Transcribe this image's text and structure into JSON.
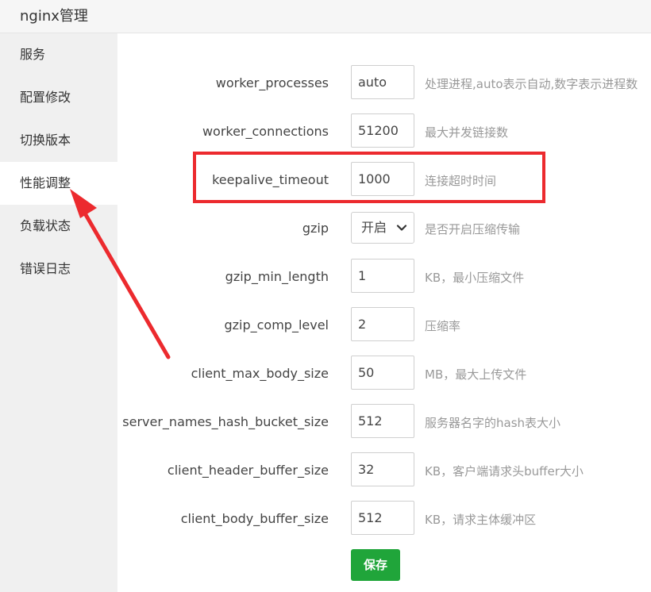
{
  "window": {
    "title": "nginx管理"
  },
  "sidebar": {
    "items": [
      {
        "label": "服务",
        "active": false
      },
      {
        "label": "配置修改",
        "active": false
      },
      {
        "label": "切换版本",
        "active": false
      },
      {
        "label": "性能调整",
        "active": true
      },
      {
        "label": "负载状态",
        "active": false
      },
      {
        "label": "错误日志",
        "active": false
      }
    ]
  },
  "form": {
    "rows": [
      {
        "label": "worker_processes",
        "value": "auto",
        "description": "处理进程,auto表示自动,数字表示进程数"
      },
      {
        "label": "worker_connections",
        "value": "51200",
        "description": "最大并发链接数"
      },
      {
        "label": "keepalive_timeout",
        "value": "1000",
        "description": "连接超时时间"
      },
      {
        "label": "gzip",
        "value": "开启",
        "description": "是否开启压缩传输",
        "type": "select"
      },
      {
        "label": "gzip_min_length",
        "value": "1",
        "description": "KB，最小压缩文件"
      },
      {
        "label": "gzip_comp_level",
        "value": "2",
        "description": "压缩率"
      },
      {
        "label": "client_max_body_size",
        "value": "50",
        "description": "MB，最大上传文件"
      },
      {
        "label": "server_names_hash_bucket_size",
        "value": "512",
        "description": "服务器名字的hash表大小"
      },
      {
        "label": "client_header_buffer_size",
        "value": "32",
        "description": "KB，客户端请求头buffer大小"
      },
      {
        "label": "client_body_buffer_size",
        "value": "512",
        "description": "KB，请求主体缓冲区"
      }
    ],
    "save_label": "保存"
  },
  "colors": {
    "accent_green": "#20a53a",
    "highlight_red": "#ec2a2e",
    "sidebar_bg": "#f0f0f0"
  }
}
